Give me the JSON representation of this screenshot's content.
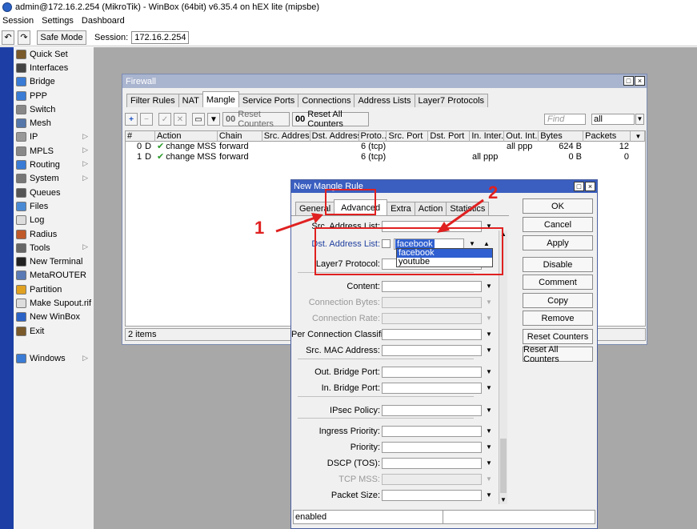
{
  "window_title": "admin@172.16.2.254 (MikroTik) - WinBox (64bit) v6.35.4 on hEX lite (mipsbe)",
  "menu": [
    "Session",
    "Settings",
    "Dashboard"
  ],
  "toolbar": {
    "undo": "↶",
    "redo": "↷",
    "safe_mode": "Safe Mode",
    "session_label": "Session:",
    "session_value": "172.16.2.254"
  },
  "sidebar": [
    {
      "label": "Quick Set",
      "icon": "quick-set-icon",
      "color": "#7a5a2a",
      "arrow": false
    },
    {
      "label": "Interfaces",
      "icon": "interfaces-icon",
      "color": "#444444",
      "arrow": false
    },
    {
      "label": "Bridge",
      "icon": "bridge-icon",
      "color": "#3a7bd5",
      "arrow": false
    },
    {
      "label": "PPP",
      "icon": "ppp-icon",
      "color": "#3a7bd5",
      "arrow": false
    },
    {
      "label": "Switch",
      "icon": "switch-icon",
      "color": "#888888",
      "arrow": false
    },
    {
      "label": "Mesh",
      "icon": "mesh-icon",
      "color": "#5577aa",
      "arrow": false
    },
    {
      "label": "IP",
      "icon": "ip-icon",
      "color": "#999999",
      "arrow": true
    },
    {
      "label": "MPLS",
      "icon": "mpls-icon",
      "color": "#888888",
      "arrow": true
    },
    {
      "label": "Routing",
      "icon": "routing-icon",
      "color": "#3a7bd5",
      "arrow": true
    },
    {
      "label": "System",
      "icon": "system-icon",
      "color": "#777777",
      "arrow": true
    },
    {
      "label": "Queues",
      "icon": "queues-icon",
      "color": "#555555",
      "arrow": false
    },
    {
      "label": "Files",
      "icon": "files-icon",
      "color": "#4a8ad5",
      "arrow": false
    },
    {
      "label": "Log",
      "icon": "log-icon",
      "color": "#dddddd",
      "arrow": false
    },
    {
      "label": "Radius",
      "icon": "radius-icon",
      "color": "#c05a2a",
      "arrow": false
    },
    {
      "label": "Tools",
      "icon": "tools-icon",
      "color": "#666666",
      "arrow": true
    },
    {
      "label": "New Terminal",
      "icon": "terminal-icon",
      "color": "#222222",
      "arrow": false
    },
    {
      "label": "MetaROUTER",
      "icon": "metarouter-icon",
      "color": "#5a7ab5",
      "arrow": false
    },
    {
      "label": "Partition",
      "icon": "partition-icon",
      "color": "#e0a020",
      "arrow": false
    },
    {
      "label": "Make Supout.rif",
      "icon": "supout-icon",
      "color": "#dddddd",
      "arrow": false
    },
    {
      "label": "New WinBox",
      "icon": "winbox-icon",
      "color": "#2b62c6",
      "arrow": false
    },
    {
      "label": "Exit",
      "icon": "exit-icon",
      "color": "#7a5a2a",
      "arrow": false
    },
    {
      "label": "",
      "icon": "",
      "color": "",
      "arrow": false
    },
    {
      "label": "Windows",
      "icon": "windows-icon",
      "color": "#3a7bd5",
      "arrow": true
    }
  ],
  "firewall": {
    "title": "Firewall",
    "tabs": [
      "Filter Rules",
      "NAT",
      "Mangle",
      "Service Ports",
      "Connections",
      "Address Lists",
      "Layer7 Protocols"
    ],
    "active_tab": "Mangle",
    "reset_counters": "Reset Counters",
    "reset_all_counters": "Reset All Counters",
    "find_placeholder": "Find",
    "filter_value": "all",
    "columns": [
      "#",
      "Action",
      "Chain",
      "Src. Address",
      "Dst. Address",
      "Proto...",
      "Src. Port",
      "Dst. Port",
      "In. Inter...",
      "Out. Int...",
      "Bytes",
      "Packets"
    ],
    "rows": [
      {
        "num": "0",
        "flag": "D",
        "action": "change MSS",
        "chain": "forward",
        "src": "",
        "dst": "",
        "proto": "6 (tcp)",
        "sport": "",
        "dport": "",
        "in": "",
        "out": "all ppp",
        "bytes": "624 B",
        "packets": "12"
      },
      {
        "num": "1",
        "flag": "D",
        "action": "change MSS",
        "chain": "forward",
        "src": "",
        "dst": "",
        "proto": "6 (tcp)",
        "sport": "",
        "dport": "",
        "in": "all ppp",
        "out": "",
        "bytes": "0 B",
        "packets": "0"
      }
    ],
    "status": "2 items"
  },
  "dialog": {
    "title": "New Mangle Rule",
    "tabs": [
      "General",
      "Advanced",
      "Extra",
      "Action",
      "Statistics"
    ],
    "active_tab": "Advanced",
    "fields": {
      "src_address_list": "Src. Address List:",
      "dst_address_list": "Dst. Address List:",
      "dst_address_list_value": "facebook",
      "layer7_protocol": "Layer7 Protocol:",
      "content": "Content:",
      "connection_bytes": "Connection Bytes:",
      "connection_rate": "Connection Rate:",
      "per_connection_classifier": "Per Connection Classifier:",
      "src_mac_address": "Src. MAC Address:",
      "out_bridge_port": "Out. Bridge Port:",
      "in_bridge_port": "In. Bridge Port:",
      "ipsec_policy": "IPsec Policy:",
      "ingress_priority": "Ingress Priority:",
      "priority": "Priority:",
      "dscp": "DSCP (TOS):",
      "tcp_mss": "TCP MSS:",
      "packet_size": "Packet Size:"
    },
    "dropdown_options": [
      "facebook",
      "youtube"
    ],
    "buttons": [
      "OK",
      "Cancel",
      "Apply",
      "Disable",
      "Comment",
      "Copy",
      "Remove",
      "Reset Counters",
      "Reset All Counters"
    ],
    "status": "enabled"
  },
  "annotations": {
    "label1": "1",
    "label2": "2",
    "color": "#e02020"
  }
}
